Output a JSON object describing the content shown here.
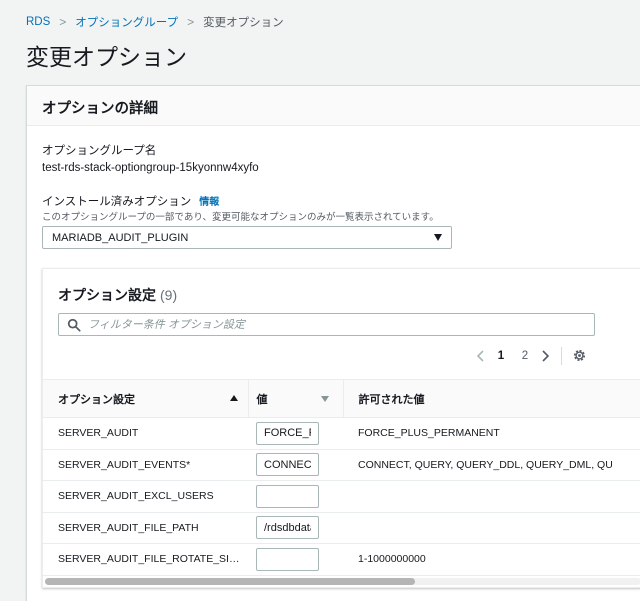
{
  "breadcrumb": {
    "items": [
      "RDS",
      "オプショングループ",
      "変更オプション"
    ],
    "separator": ">"
  },
  "page_title": "変更オプション",
  "panel": {
    "title": "オプションの詳細",
    "option_group_label": "オプショングループ名",
    "option_group_value": "test-rds-stack-optiongroup-15kyonnw4xyfo",
    "installed_label": "インストール済みオプション",
    "info_link": "情報",
    "installed_desc": "このオプショングループの一部であり、変更可能なオプションのみが一覧表示されています。",
    "selected_option": "MARIADB_AUDIT_PLUGIN"
  },
  "settings": {
    "title": "オプション設定",
    "count": "(9)",
    "filter_placeholder": "フィルター条件 オプション設定",
    "pagination": {
      "current": "1",
      "next": "2"
    },
    "columns": [
      "オプション設定",
      "値",
      "許可された値"
    ],
    "rows": [
      {
        "name": "SERVER_AUDIT",
        "value": "FORCE_PLUS_PERMANENT",
        "allowed": "FORCE_PLUS_PERMANENT"
      },
      {
        "name": "SERVER_AUDIT_EVENTS*",
        "value": "CONNECT",
        "allowed": "CONNECT, QUERY, QUERY_DDL, QUERY_DML, QU"
      },
      {
        "name": "SERVER_AUDIT_EXCL_USERS",
        "value": "",
        "allowed": ""
      },
      {
        "name": "SERVER_AUDIT_FILE_PATH",
        "value": "/rdsdbdata",
        "allowed": ""
      },
      {
        "name": "SERVER_AUDIT_FILE_ROTATE_SI…",
        "value": "",
        "allowed": "1-1000000000"
      }
    ]
  },
  "colors": {
    "link": "#0073bb",
    "border": "#aab7b8",
    "background": "#f2f3f3"
  }
}
